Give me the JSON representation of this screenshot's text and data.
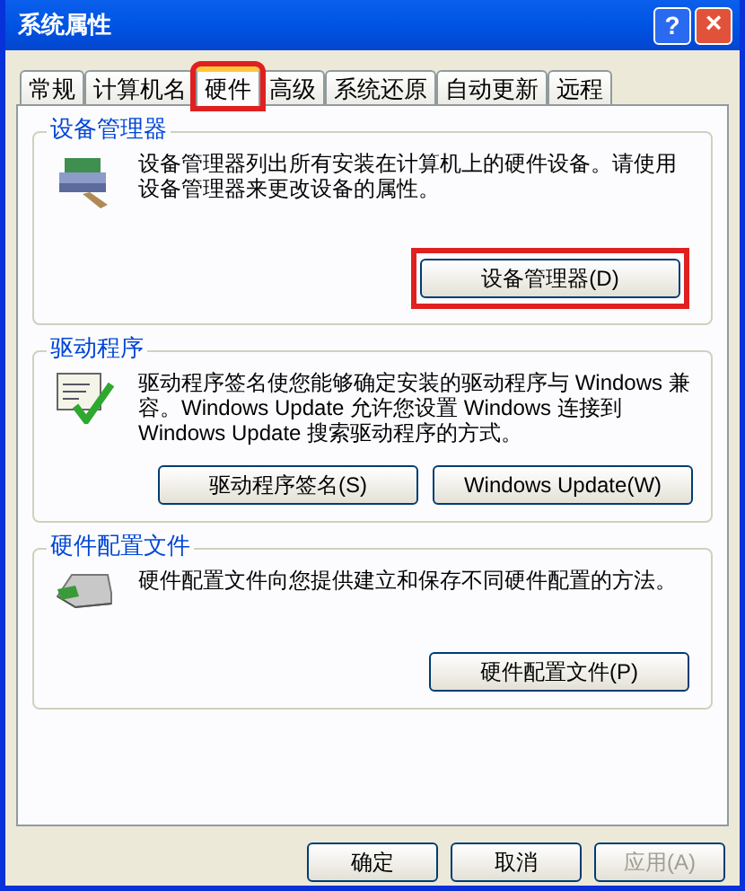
{
  "window": {
    "title": "系统属性",
    "help": "?",
    "close": "×"
  },
  "tabs": [
    {
      "label": "常规",
      "selected": false,
      "highlighted": false
    },
    {
      "label": "计算机名",
      "selected": false,
      "highlighted": false
    },
    {
      "label": "硬件",
      "selected": true,
      "highlighted": true
    },
    {
      "label": "高级",
      "selected": false,
      "highlighted": false
    },
    {
      "label": "系统还原",
      "selected": false,
      "highlighted": false
    },
    {
      "label": "自动更新",
      "selected": false,
      "highlighted": false
    },
    {
      "label": "远程",
      "selected": false,
      "highlighted": false
    }
  ],
  "groups": [
    {
      "title": "设备管理器",
      "text": "设备管理器列出所有安装在计算机上的硬件设备。请使用设备管理器来更改设备的属性。",
      "buttons": [
        {
          "label": "设备管理器(D)",
          "highlighted": true
        }
      ]
    },
    {
      "title": "驱动程序",
      "text": "驱动程序签名使您能够确定安装的驱动程序与 Windows 兼容。Windows Update 允许您设置 Windows 连接到 Windows Update 搜索驱动程序的方式。",
      "buttons": [
        {
          "label": "驱动程序签名(S)",
          "highlighted": false
        },
        {
          "label": "Windows Update(W)",
          "highlighted": false
        }
      ]
    },
    {
      "title": "硬件配置文件",
      "text": "硬件配置文件向您提供建立和保存不同硬件配置的方法。",
      "buttons": [
        {
          "label": "硬件配置文件(P)",
          "highlighted": false
        }
      ]
    }
  ],
  "footer": [
    {
      "label": "确定",
      "disabled": false
    },
    {
      "label": "取消",
      "disabled": false
    },
    {
      "label": "应用(A)",
      "disabled": true
    }
  ]
}
